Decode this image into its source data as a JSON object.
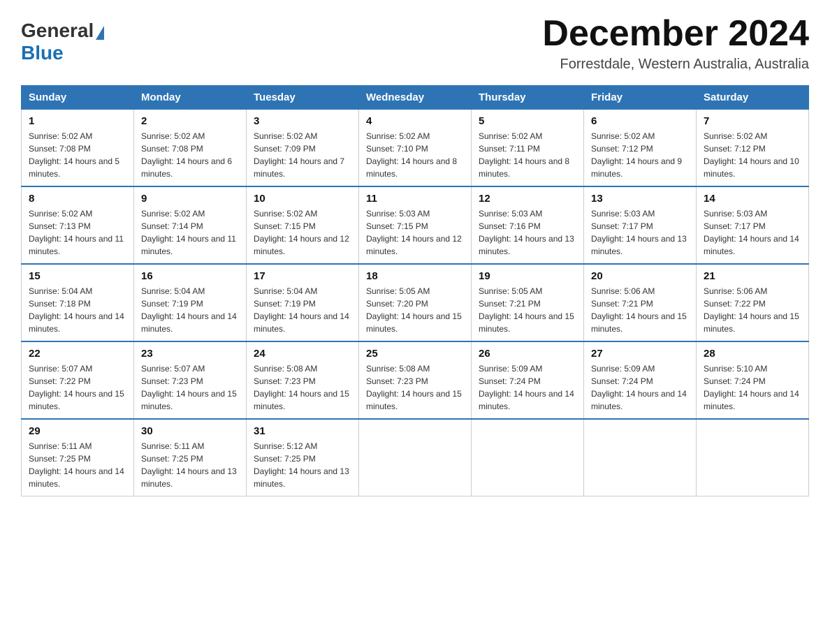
{
  "header": {
    "logo": {
      "general": "General",
      "blue": "Blue",
      "triangle": "▲"
    },
    "title": "December 2024",
    "location": "Forrestdale, Western Australia, Australia"
  },
  "weekdays": [
    "Sunday",
    "Monday",
    "Tuesday",
    "Wednesday",
    "Thursday",
    "Friday",
    "Saturday"
  ],
  "weeks": [
    [
      {
        "day": "1",
        "sunrise": "5:02 AM",
        "sunset": "7:08 PM",
        "daylight": "14 hours and 5 minutes."
      },
      {
        "day": "2",
        "sunrise": "5:02 AM",
        "sunset": "7:08 PM",
        "daylight": "14 hours and 6 minutes."
      },
      {
        "day": "3",
        "sunrise": "5:02 AM",
        "sunset": "7:09 PM",
        "daylight": "14 hours and 7 minutes."
      },
      {
        "day": "4",
        "sunrise": "5:02 AM",
        "sunset": "7:10 PM",
        "daylight": "14 hours and 8 minutes."
      },
      {
        "day": "5",
        "sunrise": "5:02 AM",
        "sunset": "7:11 PM",
        "daylight": "14 hours and 8 minutes."
      },
      {
        "day": "6",
        "sunrise": "5:02 AM",
        "sunset": "7:12 PM",
        "daylight": "14 hours and 9 minutes."
      },
      {
        "day": "7",
        "sunrise": "5:02 AM",
        "sunset": "7:12 PM",
        "daylight": "14 hours and 10 minutes."
      }
    ],
    [
      {
        "day": "8",
        "sunrise": "5:02 AM",
        "sunset": "7:13 PM",
        "daylight": "14 hours and 11 minutes."
      },
      {
        "day": "9",
        "sunrise": "5:02 AM",
        "sunset": "7:14 PM",
        "daylight": "14 hours and 11 minutes."
      },
      {
        "day": "10",
        "sunrise": "5:02 AM",
        "sunset": "7:15 PM",
        "daylight": "14 hours and 12 minutes."
      },
      {
        "day": "11",
        "sunrise": "5:03 AM",
        "sunset": "7:15 PM",
        "daylight": "14 hours and 12 minutes."
      },
      {
        "day": "12",
        "sunrise": "5:03 AM",
        "sunset": "7:16 PM",
        "daylight": "14 hours and 13 minutes."
      },
      {
        "day": "13",
        "sunrise": "5:03 AM",
        "sunset": "7:17 PM",
        "daylight": "14 hours and 13 minutes."
      },
      {
        "day": "14",
        "sunrise": "5:03 AM",
        "sunset": "7:17 PM",
        "daylight": "14 hours and 14 minutes."
      }
    ],
    [
      {
        "day": "15",
        "sunrise": "5:04 AM",
        "sunset": "7:18 PM",
        "daylight": "14 hours and 14 minutes."
      },
      {
        "day": "16",
        "sunrise": "5:04 AM",
        "sunset": "7:19 PM",
        "daylight": "14 hours and 14 minutes."
      },
      {
        "day": "17",
        "sunrise": "5:04 AM",
        "sunset": "7:19 PM",
        "daylight": "14 hours and 14 minutes."
      },
      {
        "day": "18",
        "sunrise": "5:05 AM",
        "sunset": "7:20 PM",
        "daylight": "14 hours and 15 minutes."
      },
      {
        "day": "19",
        "sunrise": "5:05 AM",
        "sunset": "7:21 PM",
        "daylight": "14 hours and 15 minutes."
      },
      {
        "day": "20",
        "sunrise": "5:06 AM",
        "sunset": "7:21 PM",
        "daylight": "14 hours and 15 minutes."
      },
      {
        "day": "21",
        "sunrise": "5:06 AM",
        "sunset": "7:22 PM",
        "daylight": "14 hours and 15 minutes."
      }
    ],
    [
      {
        "day": "22",
        "sunrise": "5:07 AM",
        "sunset": "7:22 PM",
        "daylight": "14 hours and 15 minutes."
      },
      {
        "day": "23",
        "sunrise": "5:07 AM",
        "sunset": "7:23 PM",
        "daylight": "14 hours and 15 minutes."
      },
      {
        "day": "24",
        "sunrise": "5:08 AM",
        "sunset": "7:23 PM",
        "daylight": "14 hours and 15 minutes."
      },
      {
        "day": "25",
        "sunrise": "5:08 AM",
        "sunset": "7:23 PM",
        "daylight": "14 hours and 15 minutes."
      },
      {
        "day": "26",
        "sunrise": "5:09 AM",
        "sunset": "7:24 PM",
        "daylight": "14 hours and 14 minutes."
      },
      {
        "day": "27",
        "sunrise": "5:09 AM",
        "sunset": "7:24 PM",
        "daylight": "14 hours and 14 minutes."
      },
      {
        "day": "28",
        "sunrise": "5:10 AM",
        "sunset": "7:24 PM",
        "daylight": "14 hours and 14 minutes."
      }
    ],
    [
      {
        "day": "29",
        "sunrise": "5:11 AM",
        "sunset": "7:25 PM",
        "daylight": "14 hours and 14 minutes."
      },
      {
        "day": "30",
        "sunrise": "5:11 AM",
        "sunset": "7:25 PM",
        "daylight": "14 hours and 13 minutes."
      },
      {
        "day": "31",
        "sunrise": "5:12 AM",
        "sunset": "7:25 PM",
        "daylight": "14 hours and 13 minutes."
      },
      null,
      null,
      null,
      null
    ]
  ],
  "labels": {
    "sunrise": "Sunrise:",
    "sunset": "Sunset:",
    "daylight": "Daylight:"
  }
}
